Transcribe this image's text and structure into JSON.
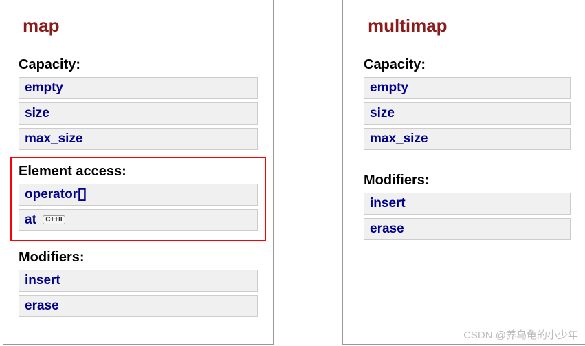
{
  "left": {
    "title": "map",
    "sections": [
      {
        "header": "Capacity:",
        "highlight": false,
        "items": [
          {
            "label": "empty",
            "badge": null
          },
          {
            "label": "size",
            "badge": null
          },
          {
            "label": "max_size",
            "badge": null
          }
        ]
      },
      {
        "header": "Element access:",
        "highlight": true,
        "items": [
          {
            "label": "operator[]",
            "badge": null
          },
          {
            "label": "at",
            "badge": "C++II"
          }
        ]
      },
      {
        "header": "Modifiers:",
        "highlight": false,
        "items": [
          {
            "label": "insert",
            "badge": null
          },
          {
            "label": "erase",
            "badge": null
          }
        ]
      }
    ]
  },
  "right": {
    "title": "multimap",
    "sections": [
      {
        "header": "Capacity:",
        "highlight": false,
        "items": [
          {
            "label": "empty",
            "badge": null
          },
          {
            "label": "size",
            "badge": null
          },
          {
            "label": "max_size",
            "badge": null
          }
        ]
      },
      {
        "header": "Modifiers:",
        "highlight": false,
        "items": [
          {
            "label": "insert",
            "badge": null
          },
          {
            "label": "erase",
            "badge": null
          }
        ]
      }
    ]
  },
  "watermark": "CSDN @养乌龟的小少年"
}
